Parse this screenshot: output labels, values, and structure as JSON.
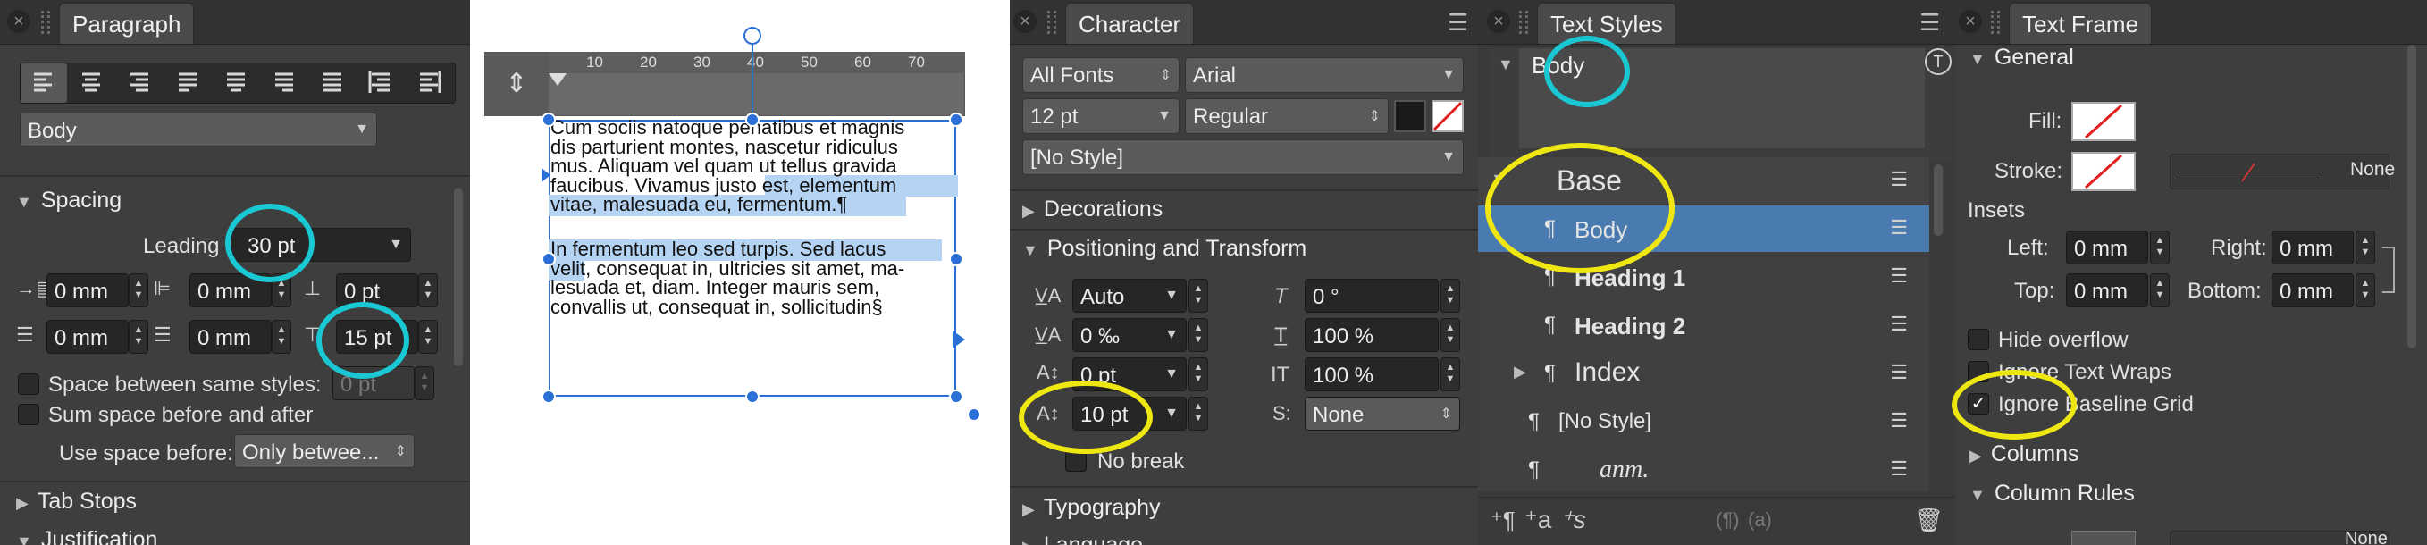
{
  "paragraph": {
    "tab": "Paragraph",
    "style_value": "Body",
    "spacing_label": "Spacing",
    "leading_label": "Leading",
    "leading_value": "30 pt",
    "left_indent": "0 mm",
    "first_line_indent": "0 mm",
    "space_before": "0 pt",
    "right_indent": "0 mm",
    "second_right": "0 mm",
    "space_after": "15 pt",
    "space_between_label": "Space between same styles:",
    "space_between_value": "0 pt",
    "sum_space_label": "Sum space before and after",
    "use_space_label": "Use space before:",
    "use_space_value": "Only betwee...",
    "tab_stops": "Tab Stops",
    "justification": "Justification"
  },
  "document": {
    "ruler_ticks": [
      "10",
      "20",
      "30",
      "40",
      "50",
      "60",
      "70"
    ],
    "paragraph1": [
      "Cum sociis natoque penatibus et magnis",
      "dis parturient montes, nascetur ridiculus",
      "mus. Aliquam vel quam ut tellus gravida",
      "faucibus. Vivamus justo est, elementum",
      "vitae, malesuada eu, fermentum.¶"
    ],
    "paragraph2": [
      "In fermentum leo sed turpis. Sed lacus",
      "velit, consequat in, ultricies sit amet, ma-",
      "lesuada et, diam. Integer mauris sem,",
      "convallis ut, consequat in, sollicitudin§"
    ]
  },
  "character": {
    "tab": "Character",
    "font_collection": "All Fonts",
    "font_family": "Arial",
    "font_size": "12 pt",
    "font_weight": "Regular",
    "char_style": "[No Style]",
    "decorations": "Decorations",
    "positioning": "Positioning and Transform",
    "kerning": "Auto",
    "tracking": "0 ‰",
    "baseline": "0 pt",
    "leading_override": "10 pt",
    "italic_angle": "0 °",
    "scale_v": "100 %",
    "scale_h": "100 %",
    "sup_sub": "None",
    "no_break": "No break",
    "typography": "Typography",
    "language": "Language"
  },
  "text_styles": {
    "tab": "Text Styles",
    "preview": "Body",
    "items": [
      {
        "label": "Base",
        "kind": "group"
      },
      {
        "label": "Body",
        "kind": "para"
      },
      {
        "label": "Heading 1",
        "kind": "para"
      },
      {
        "label": "Heading 2",
        "kind": "para"
      },
      {
        "label": "Index",
        "kind": "group"
      },
      {
        "label": "[No Style]",
        "kind": "para"
      },
      {
        "label": "anm.",
        "kind": "para"
      }
    ]
  },
  "text_frame": {
    "tab": "Text Frame",
    "general": "General",
    "fill_label": "Fill:",
    "stroke_label": "Stroke:",
    "stroke_none": "None",
    "insets_label": "Insets",
    "left_label": "Left:",
    "left_value": "0 mm",
    "right_label": "Right:",
    "right_value": "0 mm",
    "top_label": "Top:",
    "top_value": "0 mm",
    "bottom_label": "Bottom:",
    "bottom_value": "0 mm",
    "hide_overflow": "Hide overflow",
    "ignore_wraps": "Ignore Text Wraps",
    "ignore_grid": "Ignore Baseline Grid",
    "columns": "Columns",
    "column_rules": "Column Rules",
    "none_bottom": "None"
  },
  "colors": {
    "accent_cyan": "#19c8d3",
    "accent_yellow": "#efe712",
    "selection": "#4a7bb0",
    "highlight": "#b5d4f3"
  }
}
